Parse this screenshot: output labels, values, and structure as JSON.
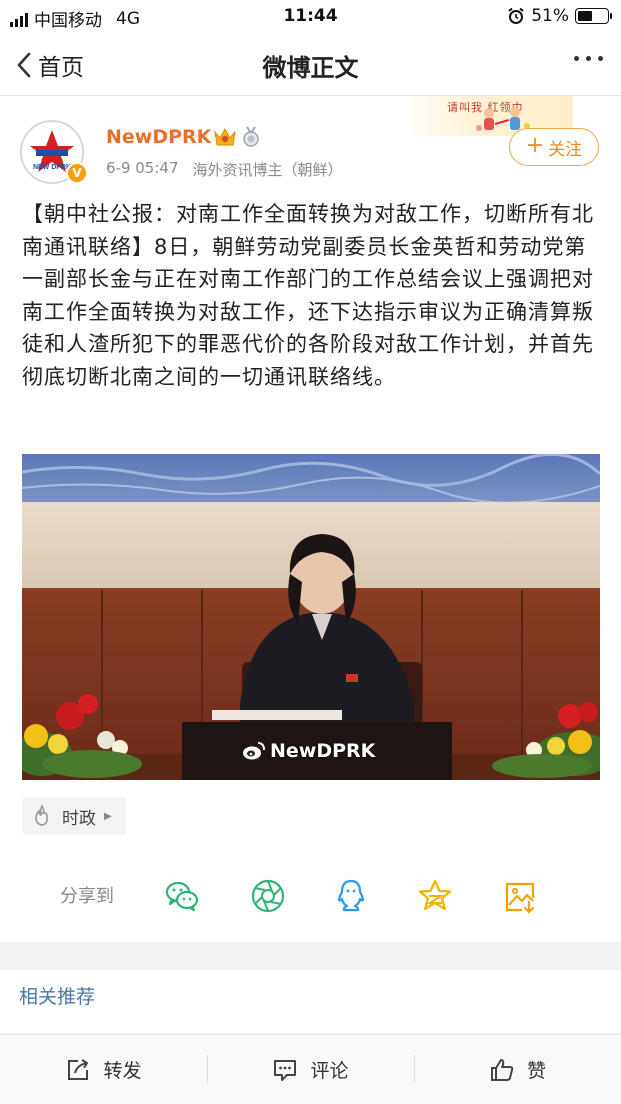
{
  "status_bar": {
    "carrier": "中国移动",
    "network": "4G",
    "time": "11:44",
    "battery_percent": "51%",
    "battery_level": 0.51
  },
  "nav": {
    "back_label": "首页",
    "title": "微博正文"
  },
  "banner": {
    "text": "请叫我 红领巾"
  },
  "author": {
    "name": "NewDPRK",
    "avatar_text": "NEW DPRK",
    "verified_mark": "V",
    "post_time": "6-9 05:47",
    "description": "海外资讯博主（朝鲜）",
    "follow_label": "关注",
    "follow_plus": "+"
  },
  "post": {
    "text": "【朝中社公报：对南工作全面转换为对敌工作，切断所有北南通讯联络】8日，朝鲜劳动党副委员长金英哲和劳动党第一副部长金与正在对南工作部门的工作总结会议上强调把对南工作全面转换为对敌工作，还下达指示审议为正确清算叛徒和人渣所犯下的罪恶代价的各阶段对敌工作计划，并首先彻底切断北南之间的一切通讯联络线。",
    "image_watermark": "NewDPRK"
  },
  "topic": {
    "label": "时政"
  },
  "share": {
    "label": "分享到",
    "targets": [
      "wechat-icon",
      "moments-icon",
      "qq-icon",
      "qzone-icon",
      "save-image-icon"
    ]
  },
  "related": {
    "title": "相关推荐"
  },
  "toolbar": {
    "repost_label": "转发",
    "comment_label": "评论",
    "like_label": "赞"
  },
  "colors": {
    "accent_orange": "#e8702a",
    "follow_border": "#f3a64b",
    "share_green": "#2bb673",
    "share_blue": "#2b9be8",
    "share_gold": "#f0b400",
    "link_blue": "#4a77a8"
  }
}
